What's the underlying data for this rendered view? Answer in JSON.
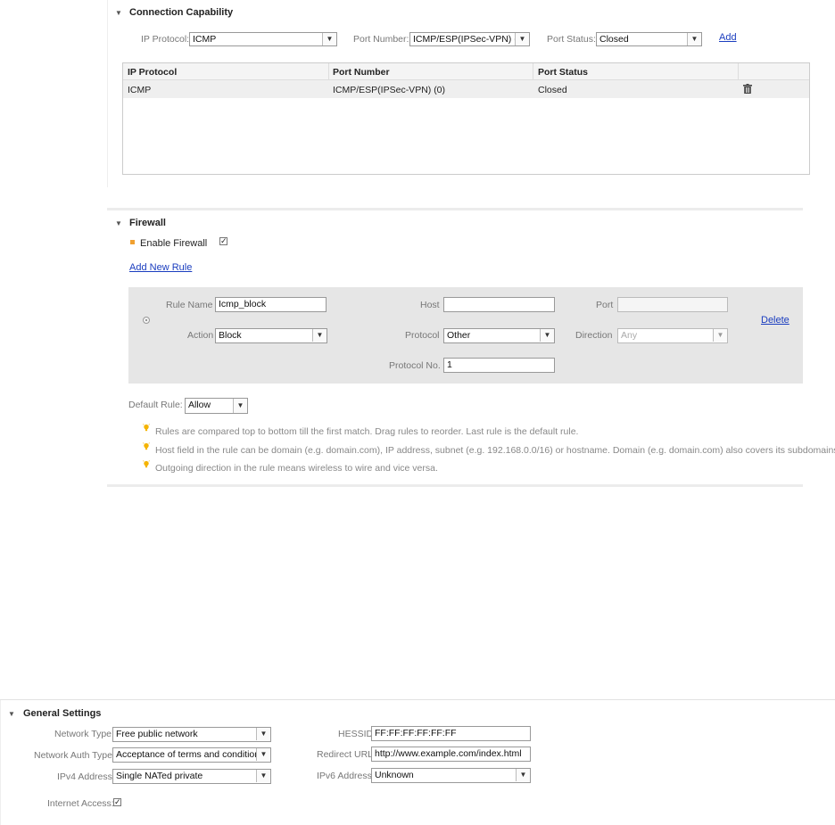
{
  "connection": {
    "title": "Connection Capability",
    "ip_protocol_label": "IP Protocol:",
    "ip_protocol_value": "ICMP",
    "port_number_label": "Port Number:",
    "port_number_value": "ICMP/ESP(IPSec-VPN) (0)",
    "port_status_label": "Port Status:",
    "port_status_value": "Closed",
    "add_label": "Add",
    "table": {
      "headers": [
        "IP Protocol",
        "Port Number",
        "Port Status"
      ],
      "rows": [
        {
          "ip_protocol": "ICMP",
          "port_number": "ICMP/ESP(IPSec-VPN) (0)",
          "port_status": "Closed",
          "delete_icon": "trash-icon"
        }
      ]
    }
  },
  "firewall": {
    "title": "Firewall",
    "enable_label": "Enable Firewall",
    "enable_checked": true,
    "add_rule_label": "Add New Rule",
    "rule": {
      "rule_name_label": "Rule Name",
      "rule_name_value": "Icmp_block",
      "host_label": "Host",
      "host_value": "",
      "port_label": "Port",
      "port_value": "",
      "action_label": "Action",
      "action_value": "Block",
      "protocol_label": "Protocol",
      "protocol_value": "Other",
      "direction_label": "Direction",
      "direction_value": "Any",
      "protocol_no_label": "Protocol No.",
      "protocol_no_value": "1",
      "delete_label": "Delete"
    },
    "default_rule_label": "Default Rule:",
    "default_rule_value": "Allow",
    "tips": [
      "Rules are compared top to bottom till the first match. Drag rules to reorder. Last rule is the default rule.",
      "Host field in the rule can be domain (e.g. domain.com), IP address, subnet (e.g. 192.168.0.0/16) or hostname. Domain (e.g. domain.com) also covers its subdomains",
      "Outgoing direction in the rule means wireless to wire and vice versa."
    ]
  },
  "general": {
    "title": "General Settings",
    "network_type_label": "Network Type:",
    "network_type_value": "Free public network",
    "network_auth_label": "Network Auth Type:",
    "network_auth_value": "Acceptance of terms and conditions",
    "ipv4_label": "IPv4 Address:",
    "ipv4_value": "Single NATed private",
    "hessid_label": "HESSID:",
    "hessid_value": "FF:FF:FF:FF:FF:FF",
    "redirect_label": "Redirect URL:",
    "redirect_value": "http://www.example.com/index.html",
    "ipv6_label": "IPv6 Address:",
    "ipv6_value": "Unknown",
    "internet_access_label": "Internet Access:",
    "internet_access_checked": true
  },
  "colors": {
    "link": "#1a3dbf",
    "rule_panel_bg": "#e6e6e6",
    "bullet": "#f0a030",
    "tip_bulb": "#f5b400"
  }
}
